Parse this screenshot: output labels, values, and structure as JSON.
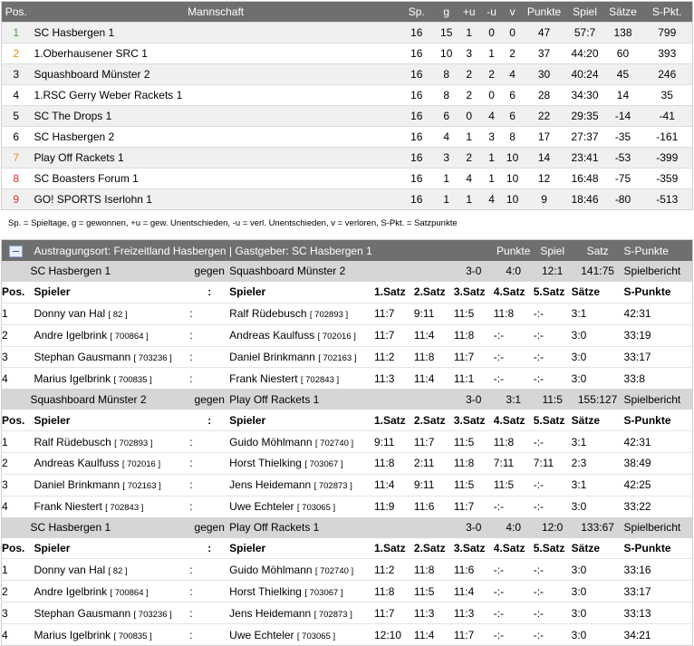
{
  "standings": {
    "headers": [
      "Pos.",
      "Mannschaft",
      "Sp.",
      "g",
      "+u",
      "-u",
      "v",
      "Punkte",
      "Spiel",
      "Sätze",
      "S-Pkt."
    ],
    "pos_colors": {
      "green": "#3aaa35",
      "orange": "#e88a1a",
      "red": "#e03030",
      "black": "#000000"
    },
    "rows": [
      {
        "pos": "1",
        "team": "SC Hasbergen 1",
        "sp": "16",
        "g": "15",
        "pu": "1",
        "mu": "0",
        "v": "0",
        "punkte": "47",
        "spiel": "57:7",
        "saetze": "138",
        "spkt": "799",
        "pos_color": "green"
      },
      {
        "pos": "2",
        "team": "1.Oberhausener SRC 1",
        "sp": "16",
        "g": "10",
        "pu": "3",
        "mu": "1",
        "v": "2",
        "punkte": "37",
        "spiel": "44:20",
        "saetze": "60",
        "spkt": "393",
        "pos_color": "orange"
      },
      {
        "pos": "3",
        "team": "Squashboard Münster 2",
        "sp": "16",
        "g": "8",
        "pu": "2",
        "mu": "2",
        "v": "4",
        "punkte": "30",
        "spiel": "40:24",
        "saetze": "45",
        "spkt": "246",
        "pos_color": "black"
      },
      {
        "pos": "4",
        "team": "1.RSC Gerry Weber Rackets 1",
        "sp": "16",
        "g": "8",
        "pu": "2",
        "mu": "0",
        "v": "6",
        "punkte": "28",
        "spiel": "34:30",
        "saetze": "14",
        "spkt": "35",
        "pos_color": "black"
      },
      {
        "pos": "5",
        "team": "SC The Drops 1",
        "sp": "16",
        "g": "6",
        "pu": "0",
        "mu": "4",
        "v": "6",
        "punkte": "22",
        "spiel": "29:35",
        "saetze": "-14",
        "spkt": "-41",
        "pos_color": "black"
      },
      {
        "pos": "6",
        "team": "SC Hasbergen 2",
        "sp": "16",
        "g": "4",
        "pu": "1",
        "mu": "3",
        "v": "8",
        "punkte": "17",
        "spiel": "27:37",
        "saetze": "-35",
        "spkt": "-161",
        "pos_color": "black"
      },
      {
        "pos": "7",
        "team": "Play Off Rackets 1",
        "sp": "16",
        "g": "3",
        "pu": "2",
        "mu": "1",
        "v": "10",
        "punkte": "14",
        "spiel": "23:41",
        "saetze": "-53",
        "spkt": "-399",
        "pos_color": "orange"
      },
      {
        "pos": "8",
        "team": "SC Boasters Forum 1",
        "sp": "16",
        "g": "1",
        "pu": "4",
        "mu": "1",
        "v": "10",
        "punkte": "12",
        "spiel": "16:48",
        "saetze": "-75",
        "spkt": "-359",
        "pos_color": "red"
      },
      {
        "pos": "9",
        "team": "GO! SPORTS Iserlohn 1",
        "sp": "16",
        "g": "1",
        "pu": "1",
        "mu": "4",
        "v": "10",
        "punkte": "9",
        "spiel": "18:46",
        "saetze": "-80",
        "spkt": "-513",
        "pos_color": "red"
      }
    ]
  },
  "legend": "Sp. = Spieltage, g = gewonnen, +u = gew. Unentschieden, -u = verl. Unentschieden, v = verloren, S-Pkt. = Satzpunkte",
  "matchday": {
    "icon": "collapse-icon",
    "header_text": "Austragungsort: Freizeitland Hasbergen  |  Gastgeber: SC Hasbergen 1",
    "col_punkte": "Punkte",
    "col_spiel": "Spiel",
    "col_satz": "Satz",
    "col_spunkte": "S-Punkte",
    "gegen": "gegen",
    "report_label": "Spielbericht",
    "player_headers": {
      "pos": "Pos.",
      "spieler": "Spieler",
      "sep": ":",
      "spieler2": "Spieler",
      "s1": "1.Satz",
      "s2": "2.Satz",
      "s3": "3.Satz",
      "s4": "4.Satz",
      "s5": "5.Satz",
      "saetze": "Sätze",
      "spunkte": "S-Punkte"
    },
    "encounters": [
      {
        "home": "SC Hasbergen 1",
        "away": "Squashboard Münster 2",
        "punkte": "3-0",
        "spiel": "4:0",
        "satz": "12:1",
        "spunkte": "141:75",
        "games": [
          {
            "pos": "1",
            "p1": "Donny van Hal",
            "p1n": "[ 82 ]",
            "sep": ":",
            "p2": "Ralf Rüdebusch",
            "p2n": "[ 702893 ]",
            "s1": "11:7",
            "s2": "9:11",
            "s3": "11:5",
            "s4": "11:8",
            "s5": "-:-",
            "saetze": "3:1",
            "spunkte": "42:31"
          },
          {
            "pos": "2",
            "p1": "Andre Igelbrink",
            "p1n": "[ 700864 ]",
            "sep": ":",
            "p2": "Andreas Kaulfuss",
            "p2n": "[ 702016 ]",
            "s1": "11:7",
            "s2": "11:4",
            "s3": "11:8",
            "s4": "-:-",
            "s5": "-:-",
            "saetze": "3:0",
            "spunkte": "33:19"
          },
          {
            "pos": "3",
            "p1": "Stephan Gausmann",
            "p1n": "[ 703236 ]",
            "sep": ":",
            "p2": "Daniel Brinkmann",
            "p2n": "[ 702163 ]",
            "s1": "11:2",
            "s2": "11:8",
            "s3": "11:7",
            "s4": "-:-",
            "s5": "-:-",
            "saetze": "3:0",
            "spunkte": "33:17"
          },
          {
            "pos": "4",
            "p1": "Marius Igelbrink",
            "p1n": "[ 700835 ]",
            "sep": ":",
            "p2": "Frank Niestert",
            "p2n": "[ 702843 ]",
            "s1": "11:3",
            "s2": "11:4",
            "s3": "11:1",
            "s4": "-:-",
            "s5": "-:-",
            "saetze": "3:0",
            "spunkte": "33:8"
          }
        ]
      },
      {
        "home": "Squashboard Münster 2",
        "away": "Play Off Rackets 1",
        "punkte": "3-0",
        "spiel": "3:1",
        "satz": "11:5",
        "spunkte": "155:127",
        "games": [
          {
            "pos": "1",
            "p1": "Ralf Rüdebusch",
            "p1n": "[ 702893 ]",
            "sep": ":",
            "p2": "Guido Möhlmann",
            "p2n": "[ 702740 ]",
            "s1": "9:11",
            "s2": "11:7",
            "s3": "11:5",
            "s4": "11:8",
            "s5": "-:-",
            "saetze": "3:1",
            "spunkte": "42:31"
          },
          {
            "pos": "2",
            "p1": "Andreas Kaulfuss",
            "p1n": "[ 702016 ]",
            "sep": ":",
            "p2": "Horst Thielking",
            "p2n": "[ 703067 ]",
            "s1": "11:8",
            "s2": "2:11",
            "s3": "11:8",
            "s4": "7:11",
            "s5": "7:11",
            "saetze": "2:3",
            "spunkte": "38:49"
          },
          {
            "pos": "3",
            "p1": "Daniel Brinkmann",
            "p1n": "[ 702163 ]",
            "sep": ":",
            "p2": "Jens Heidemann",
            "p2n": "[ 702873 ]",
            "s1": "11:4",
            "s2": "9:11",
            "s3": "11:5",
            "s4": "11:5",
            "s5": "-:-",
            "saetze": "3:1",
            "spunkte": "42:25"
          },
          {
            "pos": "4",
            "p1": "Frank Niestert",
            "p1n": "[ 702843 ]",
            "sep": ":",
            "p2": "Uwe Echteler",
            "p2n": "[ 703065 ]",
            "s1": "11:9",
            "s2": "11:6",
            "s3": "11:7",
            "s4": "-:-",
            "s5": "-:-",
            "saetze": "3:0",
            "spunkte": "33:22"
          }
        ]
      },
      {
        "home": "SC Hasbergen 1",
        "away": "Play Off Rackets 1",
        "punkte": "3-0",
        "spiel": "4:0",
        "satz": "12:0",
        "spunkte": "133:67",
        "games": [
          {
            "pos": "1",
            "p1": "Donny van Hal",
            "p1n": "[ 82 ]",
            "sep": ":",
            "p2": "Guido Möhlmann",
            "p2n": "[ 702740 ]",
            "s1": "11:2",
            "s2": "11:8",
            "s3": "11:6",
            "s4": "-:-",
            "s5": "-:-",
            "saetze": "3:0",
            "spunkte": "33:16"
          },
          {
            "pos": "2",
            "p1": "Andre Igelbrink",
            "p1n": "[ 700864 ]",
            "sep": ":",
            "p2": "Horst Thielking",
            "p2n": "[ 703067 ]",
            "s1": "11:8",
            "s2": "11:5",
            "s3": "11:4",
            "s4": "-:-",
            "s5": "-:-",
            "saetze": "3:0",
            "spunkte": "33:17"
          },
          {
            "pos": "3",
            "p1": "Stephan Gausmann",
            "p1n": "[ 703236 ]",
            "sep": ":",
            "p2": "Jens Heidemann",
            "p2n": "[ 702873 ]",
            "s1": "11:7",
            "s2": "11:3",
            "s3": "11:3",
            "s4": "-:-",
            "s5": "-:-",
            "saetze": "3:0",
            "spunkte": "33:13"
          },
          {
            "pos": "4",
            "p1": "Marius Igelbrink",
            "p1n": "[ 700835 ]",
            "sep": ":",
            "p2": "Uwe Echteler",
            "p2n": "[ 703065 ]",
            "s1": "12:10",
            "s2": "11:4",
            "s3": "11:7",
            "s4": "-:-",
            "s5": "-:-",
            "saetze": "3:0",
            "spunkte": "34:21"
          }
        ]
      }
    ]
  }
}
